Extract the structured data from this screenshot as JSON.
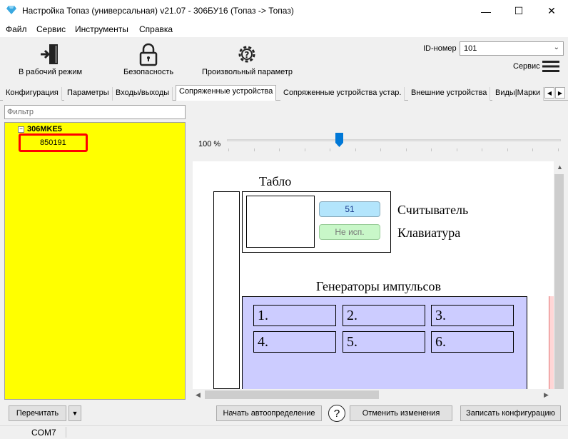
{
  "window": {
    "title": "Настройка Топаз (универсальная) v21.07 - 306БУ16 (Топаз -> Топаз)",
    "minimize_glyph": "—",
    "maximize_glyph": "☐",
    "close_glyph": "✕"
  },
  "menu": [
    "Файл",
    "Сервис",
    "Инструменты",
    "Справка"
  ],
  "toolbar": {
    "work_mode_label": "В рабочий режим",
    "security_label": "Безопасность",
    "custom_param_label": "Произвольный параметр",
    "id_label": "ID-номер",
    "id_value": "101",
    "service_label": "Сервис"
  },
  "tabs": [
    "Конфигурация",
    "Параметры",
    "Входы/выходы",
    "Сопряженные устройства",
    "Сопряженные устройства устар.",
    "Внешние устройства",
    "Виды|Марки"
  ],
  "active_tab_index": 3,
  "left_pane": {
    "filter_placeholder": "Фильтр",
    "tree_root": "306MKE5",
    "tree_child": "850191",
    "tree_expand_glyph": "−"
  },
  "zoom": {
    "label": "100 %",
    "value_percent": 100
  },
  "diagram": {
    "tablo_label": "Табло",
    "reader_value": "51",
    "keyboard_value": "Не исп.",
    "reader_label": "Считыватель",
    "keyboard_label": "Клавиатура",
    "generators_label": "Генераторы импульсов",
    "generators": [
      "1.",
      "2.",
      "3.",
      "4.",
      "5.",
      "6."
    ]
  },
  "buttons": {
    "reread": "Перечитать",
    "autodetect": "Начать автоопределение",
    "help": "?",
    "cancel_changes": "Отменить изменения",
    "write_config": "Записать конфигурацию"
  },
  "status": {
    "port": "COM7"
  },
  "colors": {
    "tree_background": "#ffff00",
    "highlight_border": "#ff0000",
    "reader_fill": "#b3e5fc",
    "keyboard_fill": "#c8f7c8",
    "generators_fill": "#ccccff",
    "slider_thumb": "#0078d7"
  }
}
